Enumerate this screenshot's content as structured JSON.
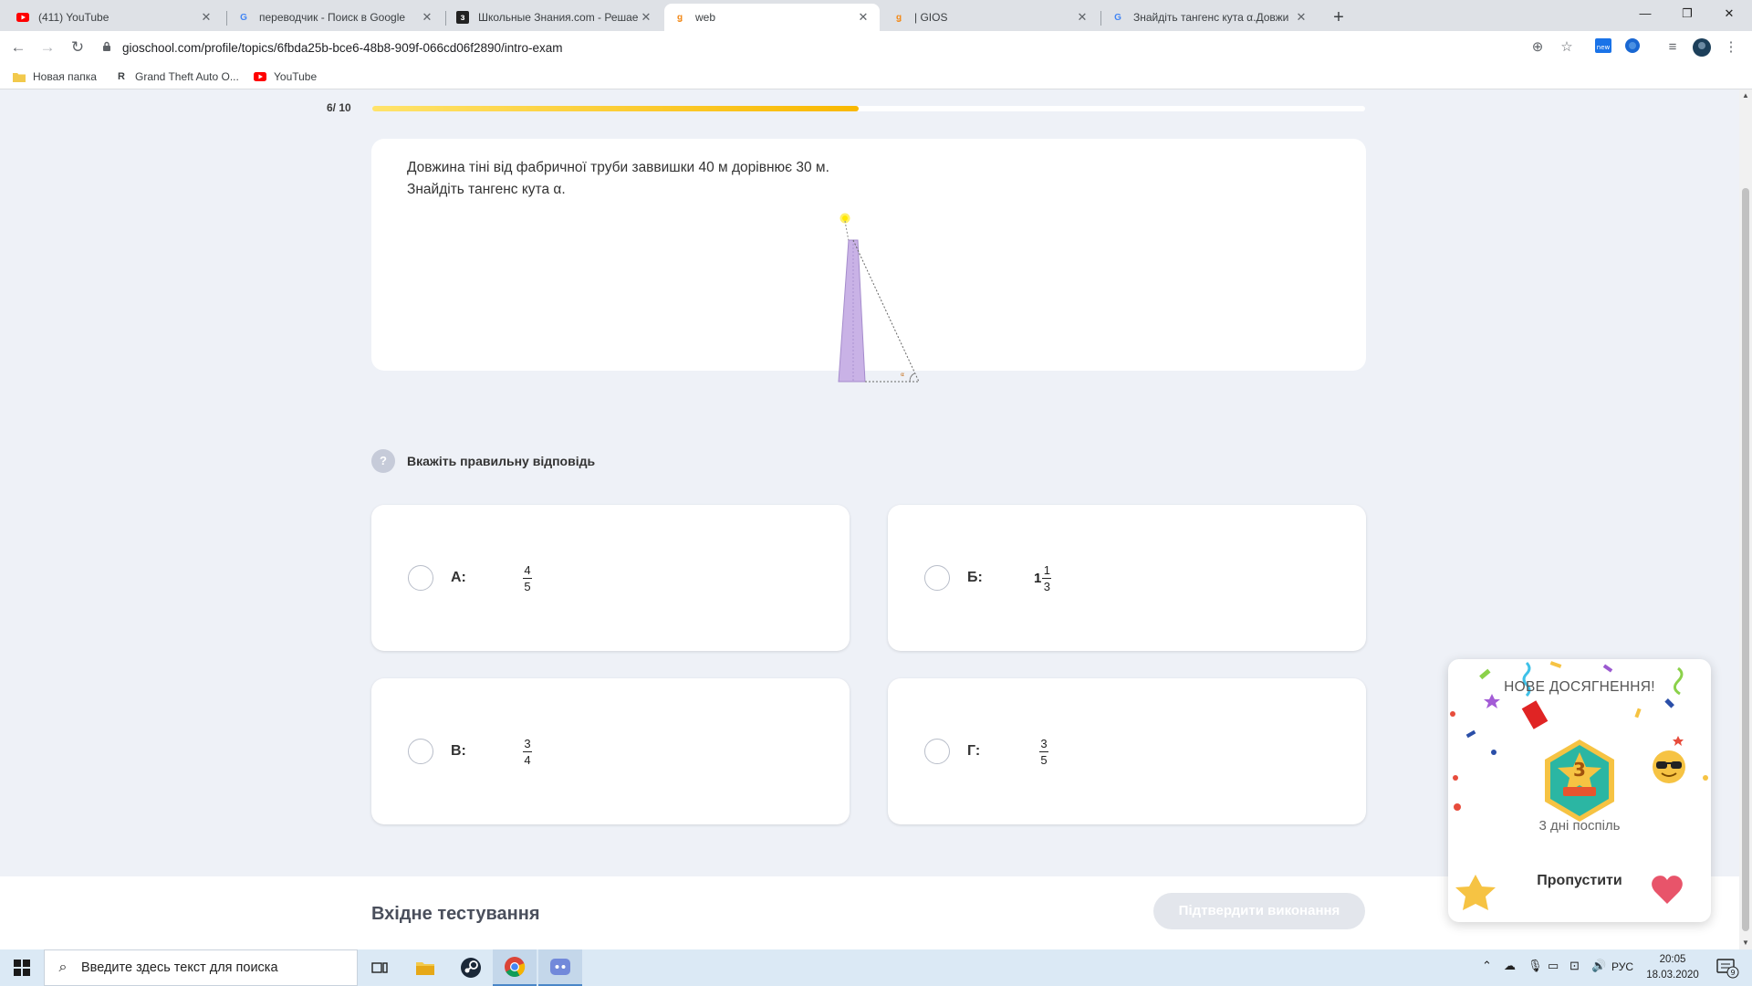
{
  "browser": {
    "tabs": [
      {
        "title": "(411) YouTube",
        "icon": "youtube-icon",
        "active": false
      },
      {
        "title": "переводчик - Поиск в Google",
        "icon": "google-icon",
        "active": false
      },
      {
        "title": "Школьные Знания.com - Решае",
        "icon": "znanija-icon",
        "active": false
      },
      {
        "title": "web",
        "icon": "gioschool-icon",
        "active": true
      },
      {
        "title": "| GIOS",
        "icon": "gioschool-icon",
        "active": false
      },
      {
        "title": "Знайдіть тангенс кута α.Довжи",
        "icon": "google-icon",
        "active": false
      }
    ],
    "url": "gioschool.com/profile/topics/6fbda25b-bce6-48b8-909f-066cd06f2890/intro-exam",
    "bookmarks": [
      {
        "label": "Новая папка",
        "icon": "folder-icon"
      },
      {
        "label": "Grand Theft Auto O...",
        "icon": "rockstar-icon"
      },
      {
        "label": "YouTube",
        "icon": "youtube-icon"
      }
    ]
  },
  "progress": {
    "label": "6/ 10",
    "fraction": 0.49
  },
  "question": {
    "line1": "Довжина тіні від фабричної труби заввишки 40 м дорівнює 30 м.",
    "line2": "Знайдіть тангенс кута α.",
    "angle_label": "α"
  },
  "instruction": {
    "hint_icon": "?",
    "text": "Вкажіть правильну відповідь"
  },
  "answers": [
    {
      "letter": "А:",
      "whole": "",
      "numerator": "4",
      "denominator": "5"
    },
    {
      "letter": "Б:",
      "whole": "1",
      "numerator": "1",
      "denominator": "3"
    },
    {
      "letter": "В:",
      "whole": "",
      "numerator": "3",
      "denominator": "4"
    },
    {
      "letter": "Г:",
      "whole": "",
      "numerator": "3",
      "denominator": "5"
    }
  ],
  "footer": {
    "title": "Вхідне тестування",
    "submit_label": "Підтвердити виконання"
  },
  "achievement": {
    "title": "НОВЕ ДОСЯГНЕННЯ!",
    "badge_number": "3",
    "subtitle": "3 дні поспіль",
    "skip_label": "Пропустити"
  },
  "taskbar": {
    "search_placeholder": "Введите здесь текст для поиска",
    "language": "РУС",
    "time": "20:05",
    "date": "18.03.2020",
    "notification_count": "9"
  },
  "colors": {
    "accent_yellow": "#f9b800",
    "chimney_purple": "#c9b2e6",
    "page_bg": "#eef1f7",
    "submit_disabled": "#e3e6ec"
  }
}
